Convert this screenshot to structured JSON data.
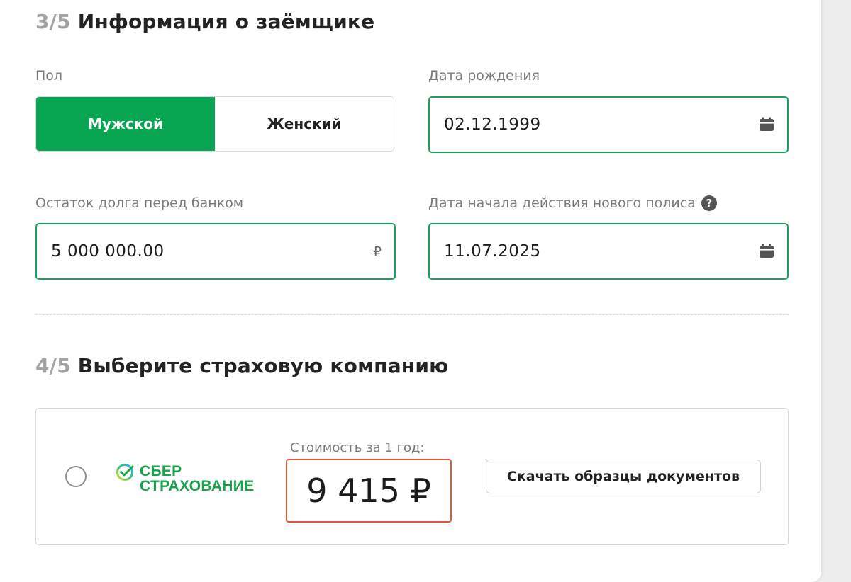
{
  "section3": {
    "step": "3/5",
    "title": "Информация о заёмщике"
  },
  "gender": {
    "label": "Пол",
    "options": [
      "Мужской",
      "Женский"
    ],
    "selected": "Мужской"
  },
  "birth_date": {
    "label": "Дата рождения",
    "value": "02.12.1999",
    "icon": "calendar-icon"
  },
  "debt": {
    "label": "Остаток долга перед банком",
    "value": "5 000 000.00",
    "currency": "₽"
  },
  "policy_start": {
    "label": "Дата начала действия нового полиса",
    "help": "?",
    "value": "11.07.2025",
    "icon": "calendar-icon"
  },
  "section4": {
    "step": "4/5",
    "title": "Выберите страховую компанию"
  },
  "offer": {
    "company_line1": "СБЕР",
    "company_line2": "СТРАХОВАНИЕ",
    "price_label": "Стоимость за 1 год:",
    "price": "9 415 ₽",
    "download_label": "Скачать образцы документов",
    "selected": false
  },
  "colors": {
    "accent": "#08a652",
    "field_border": "#19a35a",
    "price_border": "#e2573b"
  }
}
